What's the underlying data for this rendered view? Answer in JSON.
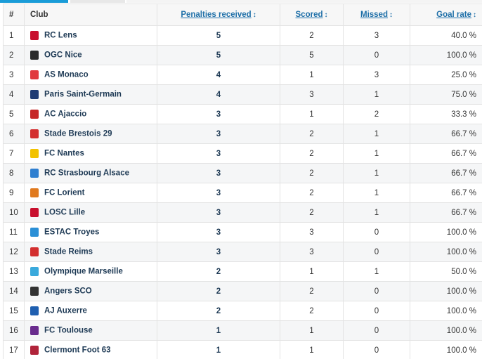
{
  "table": {
    "headers": {
      "rank": "#",
      "club": "Club",
      "penalties": "Penalties received",
      "scored": "Scored",
      "missed": "Missed",
      "rate": "Goal rate",
      "sort_glyph": "↕"
    },
    "rows": [
      {
        "rank": "1",
        "club": "RC Lens",
        "crest": "#c8102e",
        "penalties": "5",
        "scored": "2",
        "missed": "3",
        "rate": "40.0 %"
      },
      {
        "rank": "2",
        "club": "OGC Nice",
        "crest": "#2b2b2b",
        "penalties": "5",
        "scored": "5",
        "missed": "0",
        "rate": "100.0 %"
      },
      {
        "rank": "3",
        "club": "AS Monaco",
        "crest": "#e03a3e",
        "penalties": "4",
        "scored": "1",
        "missed": "3",
        "rate": "25.0 %"
      },
      {
        "rank": "4",
        "club": "Paris Saint-Germain",
        "crest": "#1f3b73",
        "penalties": "4",
        "scored": "3",
        "missed": "1",
        "rate": "75.0 %"
      },
      {
        "rank": "5",
        "club": "AC Ajaccio",
        "crest": "#c62828",
        "penalties": "3",
        "scored": "1",
        "missed": "2",
        "rate": "33.3 %"
      },
      {
        "rank": "6",
        "club": "Stade Brestois 29",
        "crest": "#d32f2f",
        "penalties": "3",
        "scored": "2",
        "missed": "1",
        "rate": "66.7 %"
      },
      {
        "rank": "7",
        "club": "FC Nantes",
        "crest": "#f2c200",
        "penalties": "3",
        "scored": "2",
        "missed": "1",
        "rate": "66.7 %"
      },
      {
        "rank": "8",
        "club": "RC Strasbourg Alsace",
        "crest": "#2f7fd0",
        "penalties": "3",
        "scored": "2",
        "missed": "1",
        "rate": "66.7 %"
      },
      {
        "rank": "9",
        "club": "FC Lorient",
        "crest": "#e07a1f",
        "penalties": "3",
        "scored": "2",
        "missed": "1",
        "rate": "66.7 %"
      },
      {
        "rank": "10",
        "club": "LOSC Lille",
        "crest": "#c8102e",
        "penalties": "3",
        "scored": "2",
        "missed": "1",
        "rate": "66.7 %"
      },
      {
        "rank": "11",
        "club": "ESTAC Troyes",
        "crest": "#2a8fd6",
        "penalties": "3",
        "scored": "3",
        "missed": "0",
        "rate": "100.0 %"
      },
      {
        "rank": "12",
        "club": "Stade Reims",
        "crest": "#d32f2f",
        "penalties": "3",
        "scored": "3",
        "missed": "0",
        "rate": "100.0 %"
      },
      {
        "rank": "13",
        "club": "Olympique Marseille",
        "crest": "#39a9dc",
        "penalties": "2",
        "scored": "1",
        "missed": "1",
        "rate": "50.0 %"
      },
      {
        "rank": "14",
        "club": "Angers SCO",
        "crest": "#333333",
        "penalties": "2",
        "scored": "2",
        "missed": "0",
        "rate": "100.0 %"
      },
      {
        "rank": "15",
        "club": "AJ Auxerre",
        "crest": "#1f5fb0",
        "penalties": "2",
        "scored": "2",
        "missed": "0",
        "rate": "100.0 %"
      },
      {
        "rank": "16",
        "club": "FC Toulouse",
        "crest": "#6a2c8e",
        "penalties": "1",
        "scored": "1",
        "missed": "0",
        "rate": "100.0 %"
      },
      {
        "rank": "17",
        "club": "Clermont Foot 63",
        "crest": "#b0233a",
        "penalties": "1",
        "scored": "1",
        "missed": "0",
        "rate": "100.0 %"
      }
    ]
  }
}
